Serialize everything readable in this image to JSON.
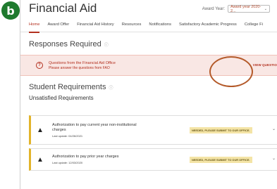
{
  "badge": "b",
  "header": {
    "title": "Financial Aid",
    "award_label": "Award Year:",
    "award_value": "Award year 2020-2..."
  },
  "tabs": [
    {
      "label": "Home",
      "active": true
    },
    {
      "label": "Award Offer",
      "active": false
    },
    {
      "label": "Financial Aid History",
      "active": false
    },
    {
      "label": "Resources",
      "active": false
    },
    {
      "label": "Notifications",
      "active": false
    },
    {
      "label": "Satisfactory Academic Progress",
      "active": false
    },
    {
      "label": "College Fi",
      "active": false
    }
  ],
  "responses": {
    "title": "Responses Required",
    "alert_title": "Questions from the Financial Aid Office",
    "alert_sub": "Please answer the questions from FAO",
    "button": "VIEW QUESTIO"
  },
  "requirements": {
    "title": "Student Requirements",
    "subtitle": "Unsatisfied Requirements",
    "items": [
      {
        "title": "Authorization to pay current year non-institutional charges",
        "date": "Last update: 04/26/2021",
        "status": "NEEDED, PLEASE SUBMIT TO OUR OFFICE."
      },
      {
        "title": "Authorization to pay prior year charges",
        "date": "Last update: 12/03/2020",
        "status": "NEEDED, PLEASE SUBMIT TO OUR OFFICE."
      }
    ]
  },
  "colors": {
    "accent": "#b3301f",
    "badge": "#1f7a2e",
    "warning_border": "#e2b42a",
    "status_bg": "#f4e4a6"
  }
}
